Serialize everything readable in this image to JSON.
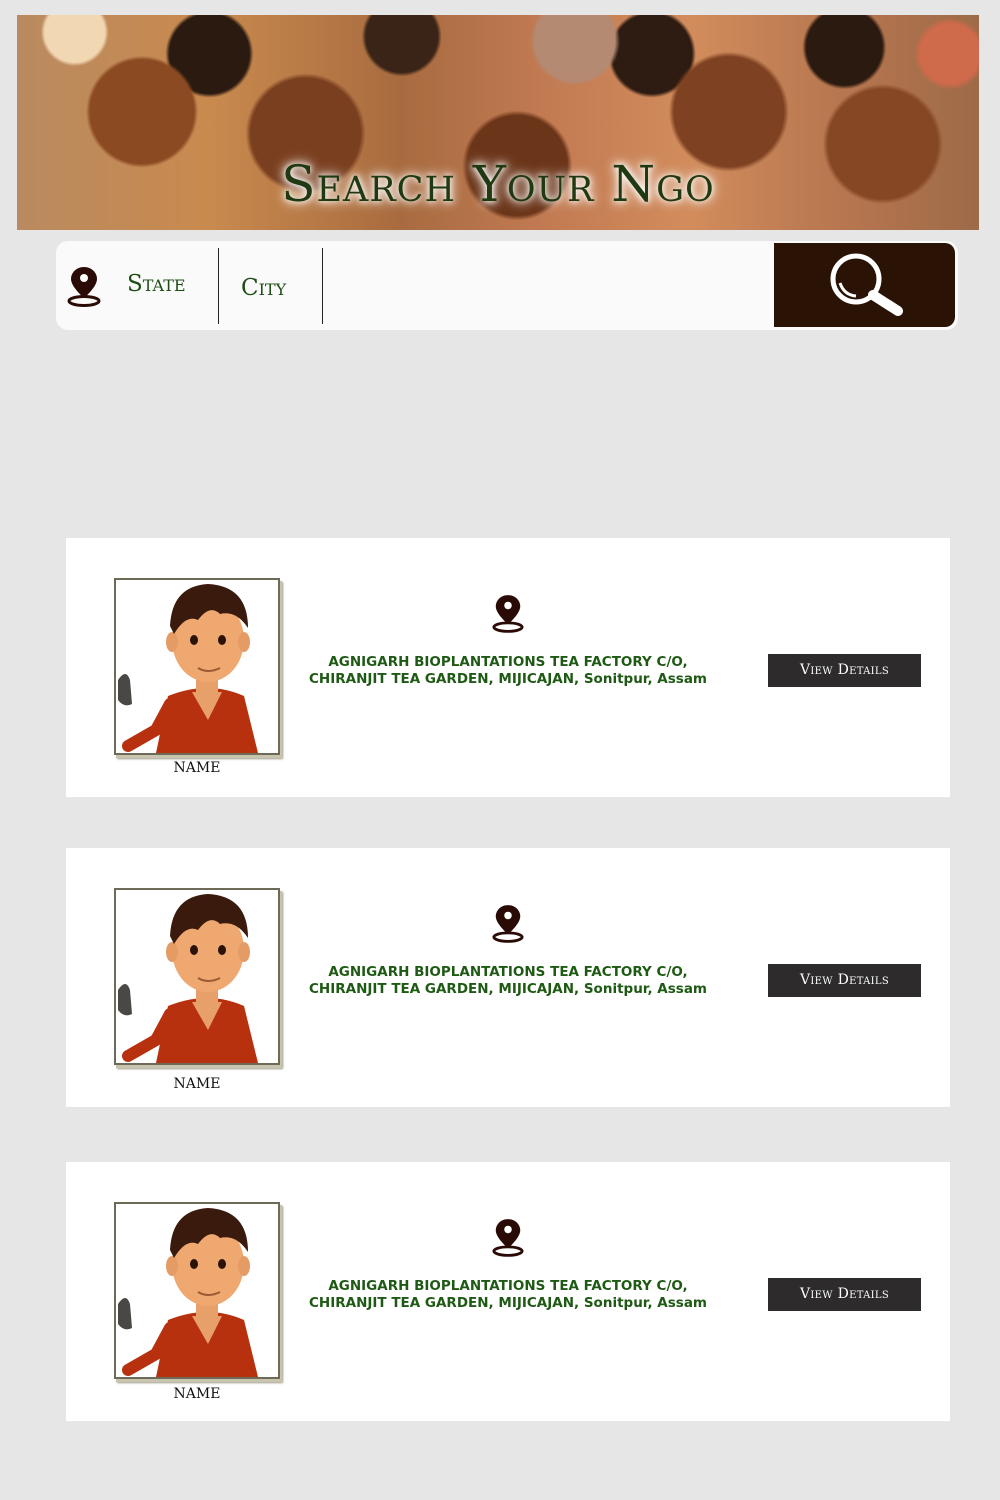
{
  "banner": {
    "title": "Search Your Ngo"
  },
  "search": {
    "state_label": "State",
    "city_label": "City",
    "button_icon": "search-icon"
  },
  "cards": [
    {
      "name": "NAME",
      "address_line1": "AGNIGARH BIOPLANTATIONS TEA FACTORY C/O,",
      "address_line2": "CHIRANJIT TEA GARDEN, MIJICAJAN, Sonitpur, Assam",
      "button_label": "View Details"
    },
    {
      "name": "NAME",
      "address_line1": "AGNIGARH BIOPLANTATIONS TEA FACTORY C/O,",
      "address_line2": "CHIRANJIT TEA GARDEN, MIJICAJAN, Sonitpur, Assam",
      "button_label": "View Details"
    },
    {
      "name": "NAME",
      "address_line1": "AGNIGARH BIOPLANTATIONS TEA FACTORY C/O,",
      "address_line2": "CHIRANJIT TEA GARDEN, MIJICAJAN, Sonitpur, Assam",
      "button_label": "View Details"
    }
  ],
  "colors": {
    "page_background": "#e6e6e6",
    "accent_dark": "#2a1305",
    "text_green": "#1e5a14",
    "button_dark": "#2d2b2b"
  }
}
